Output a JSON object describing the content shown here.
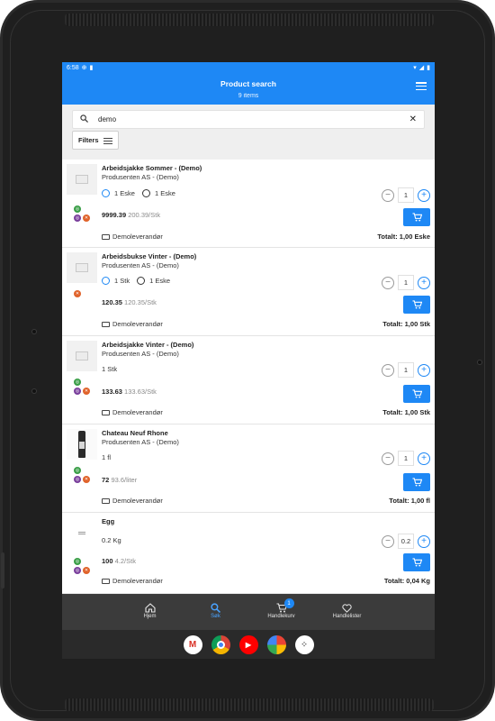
{
  "statusbar": {
    "time": "6:58"
  },
  "appbar": {
    "title": "Product search",
    "subtitle": "9 items"
  },
  "search": {
    "value": "demo",
    "filters_label": "Filters"
  },
  "products": [
    {
      "name": "Arbeidsjakke Sommer - (Demo)",
      "producer": "Produsenten AS - (Demo)",
      "units": [
        {
          "label": "1 Eske",
          "selected": true
        },
        {
          "label": "1 Eske",
          "selected": false
        }
      ],
      "qty": "1",
      "price": "9999.39",
      "unit_price": "200.39/Stk",
      "supplier": "Demoleverandør",
      "total": "Totalt: 1,00 Eske",
      "badges": [
        "g",
        "p",
        "o"
      ]
    },
    {
      "name": "Arbeidsbukse Vinter - (Demo)",
      "producer": "Produsenten AS - (Demo)",
      "units": [
        {
          "label": "1 Stk",
          "selected": true
        },
        {
          "label": "1 Eske",
          "selected": false
        }
      ],
      "qty": "1",
      "price": "120.35",
      "unit_price": "120.35/Stk",
      "supplier": "Demoleverandør",
      "total": "Totalt: 1,00 Stk",
      "badges": [
        "o"
      ]
    },
    {
      "name": "Arbeidsjakke Vinter - (Demo)",
      "producer": "Produsenten AS - (Demo)",
      "unit_text": "1 Stk",
      "qty": "1",
      "price": "133.63",
      "unit_price": "133.63/Stk",
      "supplier": "Demoleverandør",
      "total": "Totalt: 1,00 Stk",
      "badges": [
        "g",
        "p",
        "o"
      ]
    },
    {
      "name": "Chateau Neuf Rhone",
      "producer": "Produsenten AS - (Demo)",
      "unit_text": "1 fl",
      "qty": "1",
      "price": "72",
      "unit_price": "93.6/liter",
      "supplier": "Demoleverandør",
      "total": "Totalt: 1,00 fl",
      "badges": [
        "g",
        "p",
        "o"
      ]
    },
    {
      "name": "Egg",
      "producer": "",
      "unit_text": "0.2 Kg",
      "qty": "0.2",
      "price": "100",
      "unit_price": "4.2/Stk",
      "supplier": "Demoleverandør",
      "total": "Totalt: 0,04 Kg",
      "badges": [
        "g",
        "p",
        "o"
      ]
    }
  ],
  "nav": {
    "items": [
      {
        "label": "Hjem",
        "icon": "home-icon"
      },
      {
        "label": "Søk",
        "icon": "search-icon"
      },
      {
        "label": "Handlekurv",
        "icon": "cart-icon",
        "badge": "1"
      },
      {
        "label": "Handlelister",
        "icon": "heart-icon"
      }
    ]
  },
  "dock": {
    "apps": [
      "gmail-icon",
      "chrome-icon",
      "youtube-icon",
      "photos-icon",
      "app-drawer-icon"
    ]
  },
  "colors": {
    "primary": "#1e88f5",
    "nav_bg": "#3b3b3b"
  }
}
